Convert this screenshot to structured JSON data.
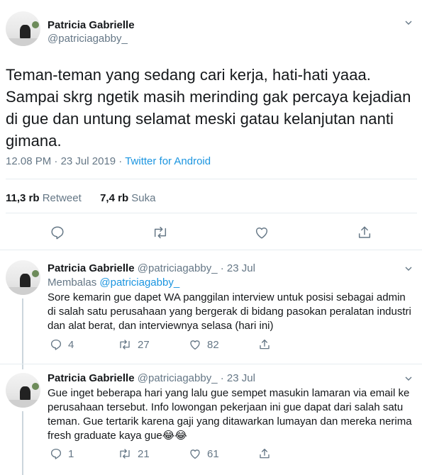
{
  "main_tweet": {
    "name": "Patricia Gabrielle",
    "handle": "@patriciagabby_",
    "text": "Teman-teman yang sedang cari kerja, hati-hati yaaa. Sampai skrg ngetik masih merinding gak percaya kejadian di gue dan untung selamat meski gatau kelanjutan nanti gimana.",
    "time": "12.08 PM",
    "date": "23 Jul 2019",
    "separator": " · ",
    "source": "Twitter for Android",
    "retweets_count": "11,3 rb",
    "retweets_label": "Retweet",
    "likes_count": "7,4 rb",
    "likes_label": "Suka"
  },
  "replies": [
    {
      "name": "Patricia Gabrielle",
      "handle": "@patriciagabby_",
      "sep": " · ",
      "date": "23 Jul",
      "replying_label": "Membalas",
      "replying_to": "@patriciagabby_",
      "text": "Sore kemarin gue dapet WA panggilan interview untuk posisi sebagai admin di salah satu perusahaan yang bergerak di bidang pasokan peralatan industri dan alat berat, dan interviewnya selasa (hari ini)",
      "reply_count": "4",
      "retweet_count": "27",
      "like_count": "82"
    },
    {
      "name": "Patricia Gabrielle",
      "handle": "@patriciagabby_",
      "sep": " · ",
      "date": "23 Jul",
      "text": "Gue inget beberapa hari yang lalu gue sempet masukin lamaran via email ke perusahaan tersebut. Info lowongan pekerjaan ini gue dapat dari salah satu teman. Gue tertarik karena gaji yang ditawarkan lumayan dan mereka nerima fresh graduate kaya gue😂😂",
      "reply_count": "1",
      "retweet_count": "21",
      "like_count": "61"
    }
  ],
  "colors": {
    "text": "#14171a",
    "secondary": "#657786",
    "link": "#1b95e0",
    "divider": "#e6ecf0"
  }
}
